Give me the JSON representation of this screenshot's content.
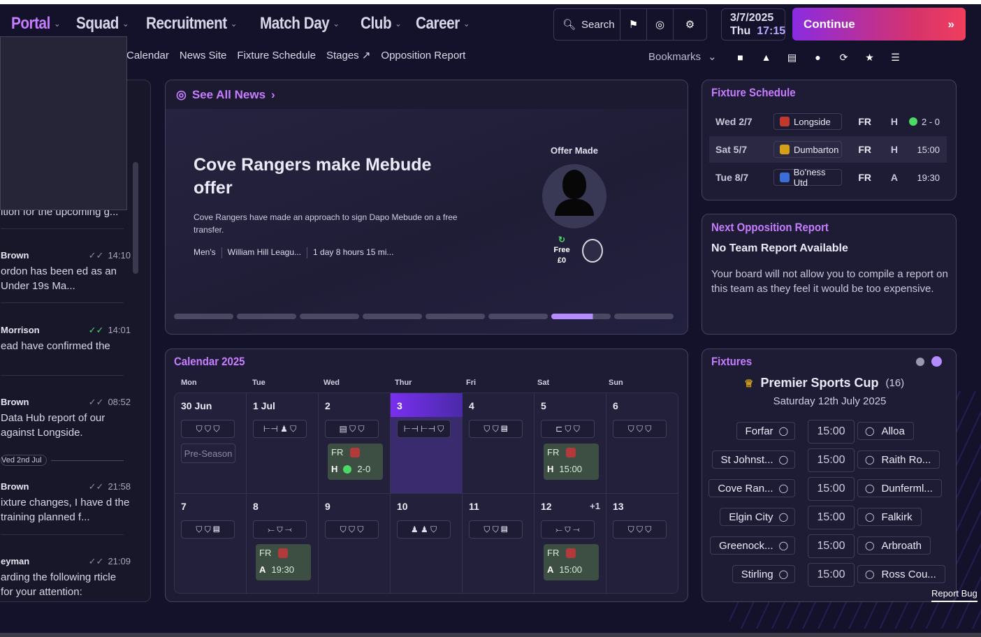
{
  "nav": {
    "items": [
      {
        "label": "Portal",
        "active": true
      },
      {
        "label": "Squad"
      },
      {
        "label": "Recruitment"
      },
      {
        "label": "Match Day"
      },
      {
        "label": "Club"
      },
      {
        "label": "Career"
      }
    ],
    "search_label": "Search",
    "date": "3/7/2025",
    "day_time_day": "Thu",
    "day_time_time": "17:15",
    "continue_label": "Continue"
  },
  "subnav": {
    "items": [
      "Calendar",
      "News Site",
      "Fixture Schedule",
      "Stages",
      "Opposition Report"
    ],
    "bookmarks_label": "Bookmarks"
  },
  "messages": [
    {
      "sender": "",
      "time": "",
      "text": "ition for the upcoming g..."
    },
    {
      "sender": "Brown",
      "time": "14:10",
      "text": "ordon has been ed as an Under 19s Ma..."
    },
    {
      "sender": "Morrison",
      "time": "14:01",
      "text": "ead have confirmed the"
    },
    {
      "sender": "Brown",
      "time": "08:52",
      "text": "Data Hub report of our against Longside."
    },
    {
      "sender": "Brown",
      "time": "21:58",
      "text": "ixture changes, I have d the training planned f..."
    },
    {
      "sender": "eyman",
      "time": "21:09",
      "text": "arding the following rticle for your attention:"
    }
  ],
  "messages_day_separator": "Ved 2nd Jul",
  "news": {
    "header": "See All News",
    "title": "Cove Rangers make Mebude offer",
    "description": "Cove Rangers have made an approach to sign Dapo Mebude on a free transfer.",
    "meta_team": "Men's",
    "meta_comp": "William Hill Leagu...",
    "meta_time": "1 day 8 hours 15 mi...",
    "offer_label": "Offer Made",
    "fee_type": "Free",
    "fee_amount": "£0",
    "carousel_count": 8,
    "carousel_active": 7
  },
  "fixture_schedule": {
    "title": "Fixture Schedule",
    "rows": [
      {
        "date": "Wed 2/7",
        "team": "Longside",
        "comp": "FR",
        "ha": "H",
        "result": "2 - 0",
        "played": true,
        "badge_color": "#c0392b"
      },
      {
        "date": "Sat 5/7",
        "team": "Dumbarton",
        "comp": "FR",
        "ha": "H",
        "result": "15:00",
        "played": false,
        "badge_color": "#d4a017"
      },
      {
        "date": "Tue 8/7",
        "team": "Bo'ness Utd",
        "comp": "FR",
        "ha": "A",
        "result": "19:30",
        "played": false,
        "badge_color": "#3b6fd6"
      }
    ]
  },
  "opposition": {
    "title": "Next Opposition Report",
    "heading": "No Team Report Available",
    "body": "Your board will not allow you to compile a report on this team as they feel it would be too expensive."
  },
  "calendar": {
    "title": "Calendar 2025",
    "days_of_week": [
      "Mon",
      "Tue",
      "Wed",
      "Thur",
      "Fri",
      "Sat",
      "Sun"
    ],
    "week1": [
      {
        "num": "30 Jun",
        "icons": "⛉ ⛉ ⛉",
        "extra": "Pre-Season"
      },
      {
        "num": "1 Jul",
        "icons": "⊢⊣ ♟ ⛉"
      },
      {
        "num": "2",
        "icons": "▤ ⛉ ⛉",
        "match": {
          "comp": "FR",
          "ha": "H",
          "result": "2-0",
          "played": true
        }
      },
      {
        "num": "3",
        "icons": "⊢⊣ ⊢⊣ ⛉",
        "today": true
      },
      {
        "num": "4",
        "icons": "⛉ ⛉ ▤"
      },
      {
        "num": "5",
        "icons": "⊏ ⛉ ⛉",
        "match": {
          "comp": "FR",
          "ha": "H",
          "result": "15:00"
        }
      },
      {
        "num": "6",
        "icons": "⛉ ⛉ ⛉"
      }
    ],
    "week2": [
      {
        "num": "7",
        "icons": "⛉ ⛉ ▤"
      },
      {
        "num": "8",
        "icons": "⤚ ⛉ ⤙",
        "match": {
          "comp": "FR",
          "ha": "A",
          "result": "19:30"
        }
      },
      {
        "num": "9",
        "icons": "⛉ ⛉ ⛉"
      },
      {
        "num": "10",
        "icons": "♟ ♟ ⛉"
      },
      {
        "num": "11",
        "icons": "⛉ ⛉ ▤"
      },
      {
        "num": "12",
        "plus": "+1",
        "icons": "⤚ ⛉ ⤙",
        "match": {
          "comp": "FR",
          "ha": "A",
          "result": "15:00"
        }
      },
      {
        "num": "13",
        "icons": "⛉ ⛉ ⛉"
      }
    ]
  },
  "fixtures": {
    "title": "Fixtures",
    "competition": "Premier Sports Cup",
    "round": "(16)",
    "date": "Saturday 12th July 2025",
    "matches": [
      {
        "home": "Forfar",
        "time": "15:00",
        "away": "Alloa"
      },
      {
        "home": "St Johnst...",
        "time": "15:00",
        "away": "Raith Ro..."
      },
      {
        "home": "Cove Ran...",
        "time": "15:00",
        "away": "Dunferml..."
      },
      {
        "home": "Elgin City",
        "time": "15:00",
        "away": "Falkirk"
      },
      {
        "home": "Greenock...",
        "time": "15:00",
        "away": "Arbroath"
      },
      {
        "home": "Stirling",
        "time": "15:00",
        "away": "Ross Cou..."
      }
    ]
  },
  "report_bug": "Report Bug"
}
